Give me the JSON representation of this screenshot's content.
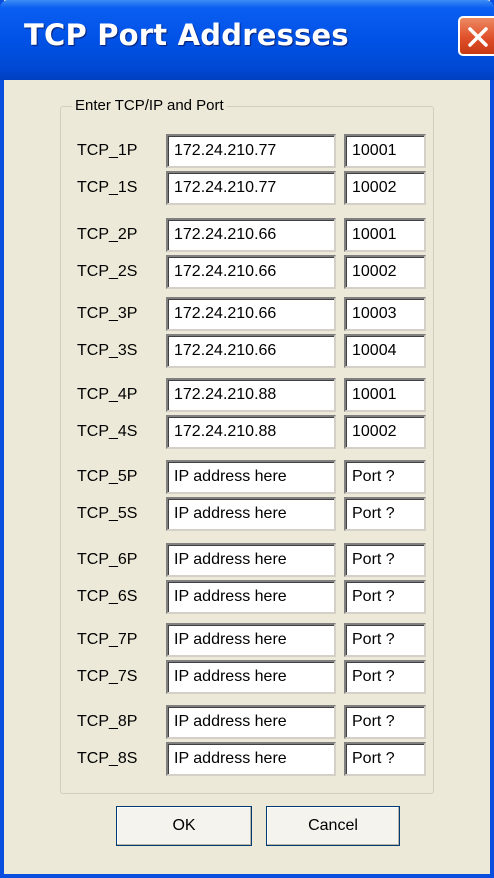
{
  "window": {
    "title": "TCP Port Addresses"
  },
  "group": {
    "label": "Enter TCP/IP and Port"
  },
  "rows": [
    {
      "label": "TCP_1P",
      "ip": "172.24.210.77",
      "port": "10001"
    },
    {
      "label": "TCP_1S",
      "ip": "172.24.210.77",
      "port": "10002"
    },
    {
      "label": "TCP_2P",
      "ip": "172.24.210.66",
      "port": "10001"
    },
    {
      "label": "TCP_2S",
      "ip": "172.24.210.66",
      "port": "10002"
    },
    {
      "label": "TCP_3P",
      "ip": "172.24.210.66",
      "port": "10003"
    },
    {
      "label": "TCP_3S",
      "ip": "172.24.210.66",
      "port": "10004"
    },
    {
      "label": "TCP_4P",
      "ip": "172.24.210.88",
      "port": "10001"
    },
    {
      "label": "TCP_4S",
      "ip": "172.24.210.88",
      "port": "10002"
    },
    {
      "label": "TCP_5P",
      "ip": "IP address here",
      "port": "Port ?"
    },
    {
      "label": "TCP_5S",
      "ip": "IP address here",
      "port": "Port ?"
    },
    {
      "label": "TCP_6P",
      "ip": "IP address here",
      "port": "Port ?"
    },
    {
      "label": "TCP_6S",
      "ip": "IP address here",
      "port": "Port ?"
    },
    {
      "label": "TCP_7P",
      "ip": "IP address here",
      "port": "Port ?"
    },
    {
      "label": "TCP_7S",
      "ip": "IP address here",
      "port": "Port ?"
    },
    {
      "label": "TCP_8P",
      "ip": "IP address here",
      "port": "Port ?"
    },
    {
      "label": "TCP_8S",
      "ip": "IP address here",
      "port": "Port ?"
    }
  ],
  "buttons": {
    "ok": "OK",
    "cancel": "Cancel"
  }
}
